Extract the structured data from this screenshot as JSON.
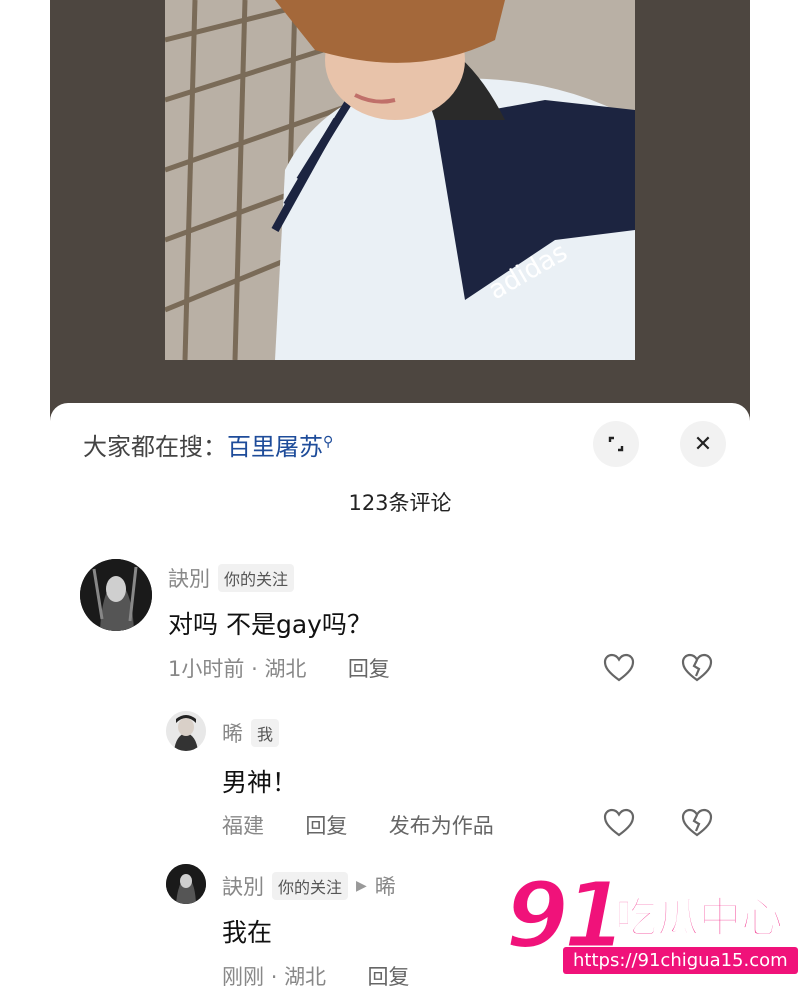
{
  "search_bar": {
    "prefix": "大家都在搜：",
    "term": "百里屠苏",
    "icon": "search-icon"
  },
  "header_buttons": {
    "expand_icon": "expand-icon",
    "close_icon": "close-icon",
    "close_glyph": "✕"
  },
  "comment_count": "123条评论",
  "comments": [
    {
      "author": "訣別",
      "tag": "你的关注",
      "text": "对吗 不是gay吗？",
      "time": "1小时前",
      "location": "湖北",
      "reply_label": "回复"
    },
    {
      "author": "晞",
      "tag": "我",
      "text": "男神！",
      "location": "福建",
      "reply_label": "回复",
      "publish_label": "发布为作品"
    },
    {
      "author": "訣別",
      "tag": "你的关注",
      "reply_to": "晞",
      "text": "我在",
      "time": "刚刚",
      "location": "湖北",
      "reply_label": "回复"
    }
  ],
  "separator": "·",
  "watermark": {
    "number": "91",
    "brand": "吃瓜中心",
    "url": "https://91chigua15.com"
  },
  "colors": {
    "accent_link": "#1e4c9a",
    "watermark": "#f0127a",
    "backdrop": "#4d4640"
  }
}
